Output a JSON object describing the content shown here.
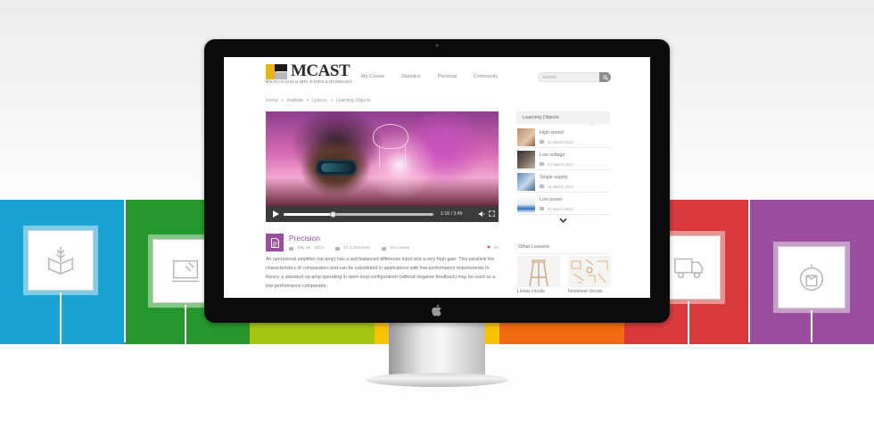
{
  "site": {
    "brand": "MCAST",
    "brand_sub": "MALTA COLLEGE of ARTS, SCIENCE & TECHNOLOGY",
    "nav": [
      "My Course",
      "Statistics",
      "Personal",
      "Community"
    ],
    "search_placeholder": "search"
  },
  "breadcrumb": [
    "Home",
    ">",
    "Institute",
    ">",
    "Lesson",
    ">",
    "Learning Objects"
  ],
  "video": {
    "time": "1:16 / 3:49",
    "progress": 0.33
  },
  "article": {
    "title": "Precision",
    "date": "July 25 , 2013",
    "comments": "12 Comments",
    "views": "124 Views",
    "likes": "18",
    "description": "An operational amplifier (op-amp) has a well balanced difference input and a very high gain. This parallels the characteristics of comparators and can be substituted in applications with low-performance requirements.In theory, a standard op-amp operating in open-loop configuration (without negative feedback) may be used as a low-performance comparator."
  },
  "learning_objects": {
    "title": "Learning Objects",
    "items": [
      {
        "title": "High speed",
        "date": "21 March 2013"
      },
      {
        "title": "Low voltage",
        "date": "21 March 2013"
      },
      {
        "title": "Single supply",
        "date": "21 March 2013"
      },
      {
        "title": "Low power",
        "date": "21 March 2013"
      }
    ]
  },
  "other_lessons": {
    "title": "Other Lessons",
    "items": [
      {
        "title": "Linear circuts"
      },
      {
        "title": "Nonlinear circuts"
      }
    ]
  },
  "colors": {
    "accent": "#9a4f9e",
    "band": [
      "#1aa3d2",
      "#26972c",
      "#a7c613",
      "#f7c300",
      "#f26b10",
      "#d8393c",
      "#9a4f9e"
    ]
  },
  "icons": [
    "wheat-book-icon",
    "drafting-board-icon",
    "truck-icon",
    "compass-box-icon",
    "search-icon",
    "document-icon",
    "calendar-icon",
    "comment-icon",
    "eye-icon",
    "heart-icon",
    "play-icon",
    "volume-icon",
    "fullscreen-icon",
    "chevron-down-icon",
    "apple-logo-icon"
  ]
}
